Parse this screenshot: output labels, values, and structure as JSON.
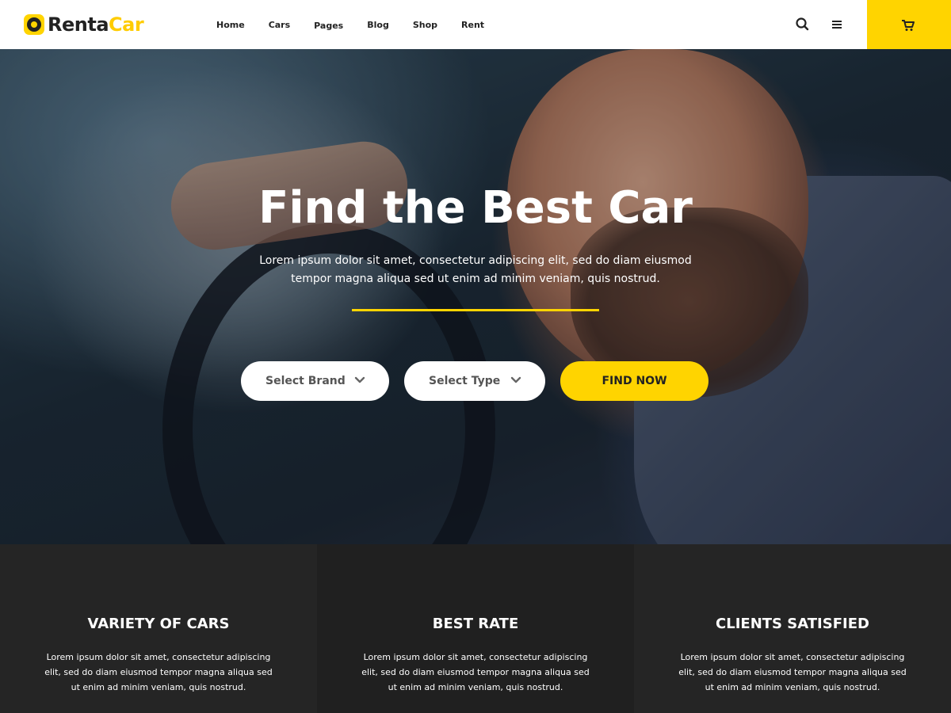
{
  "brand": {
    "name_a": "Renta",
    "name_b": "Car",
    "accent": "#ffd400"
  },
  "nav": {
    "items": [
      {
        "label": "Home"
      },
      {
        "label": "Cars"
      },
      {
        "label": "Pages"
      },
      {
        "label": "Blog"
      },
      {
        "label": "Shop"
      },
      {
        "label": "Rent"
      }
    ]
  },
  "header": {
    "icons": [
      "search-icon",
      "menu-icon",
      "cart-icon"
    ]
  },
  "hero": {
    "title": "Find the Best Car",
    "subtitle": "Lorem ipsum dolor sit amet, consectetur adipiscing elit, sed do diam eiusmod tempor magna aliqua sed ut enim ad minim veniam, quis nostrud.",
    "brand_select": "Select Brand",
    "type_select": "Select Type",
    "find_button": "FIND NOW"
  },
  "features": [
    {
      "title": "VARIETY OF CARS",
      "text": "Lorem ipsum dolor sit amet, consectetur adipiscing elit, sed do diam eiusmod tempor magna aliqua sed ut enim ad minim veniam, quis nostrud."
    },
    {
      "title": "BEST RATE",
      "text": "Lorem ipsum dolor sit amet, consectetur adipiscing elit, sed do diam eiusmod tempor magna aliqua sed ut enim ad minim veniam, quis nostrud."
    },
    {
      "title": "CLIENTS SATISFIED",
      "text": "Lorem ipsum dolor sit amet, consectetur adipiscing elit, sed do diam eiusmod tempor magna aliqua sed ut enim ad minim veniam, quis nostrud."
    }
  ]
}
